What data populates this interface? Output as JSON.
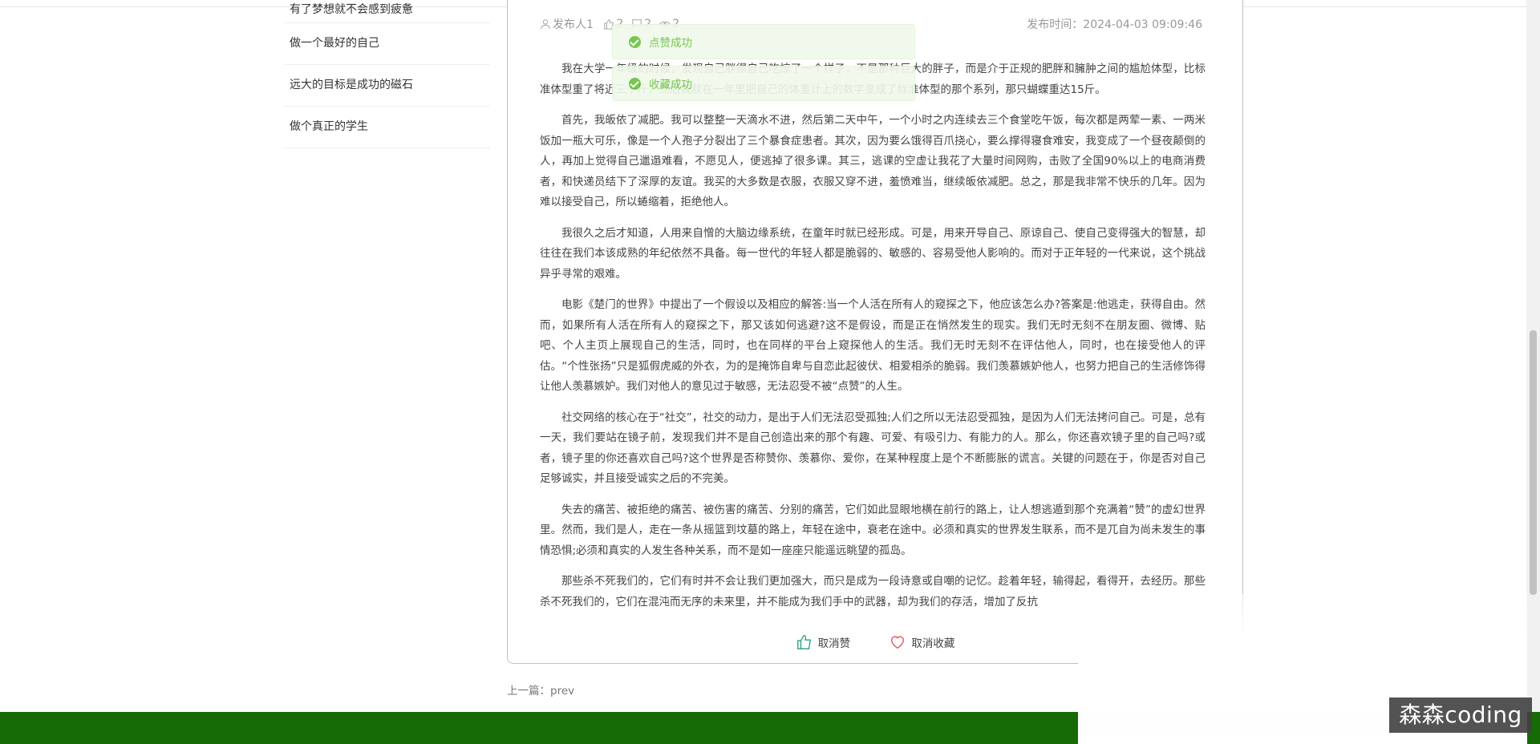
{
  "sidebar": {
    "items": [
      {
        "label": "有了梦想就不会感到疲惫"
      },
      {
        "label": "做一个最好的自己"
      },
      {
        "label": "远大的目标是成功的磁石"
      },
      {
        "label": "做个真正的学生"
      }
    ]
  },
  "article": {
    "author": "发布人1",
    "likes": "2",
    "comments": "2",
    "views": "2",
    "publish_time": "发布时间：2024-04-03 09:09:46",
    "paragraphs": [
      "我在大学一年级的时候，发现自己胖得自己吃惊了一个样子，不是那种巨大的胖子，而是介于正规的肥胖和臃肿之间的尴尬体型，比标准体型重了将近三十斤，然后我就在一年里把自己的体重计上的数字变成了标准体型的那个系列，那只蝴蝶重达15斤。",
      "首先，我皈依了减肥。我可以整整一天滴水不进，然后第二天中午，一个小时之内连续去三个食堂吃午饭，每次都是两荤一素、一两米饭加一瓶大可乐，像是一个人孢子分裂出了三个暴食症患者。其次，因为要么饿得百爪挠心，要么撑得寝食难安，我变成了一个昼夜颠倒的人，再加上觉得自己邋遢难看，不愿见人，便逃掉了很多课。其三，逃课的空虚让我花了大量时间网购，击败了全国90%以上的电商消费者，和快递员结下了深厚的友谊。我买的大多数是衣服，衣服又穿不进，羞愤难当，继续皈依减肥。总之，那是我非常不快乐的几年。因为难以接受自己，所以蜷缩着，拒绝他人。",
      "我很久之后才知道，人用来自憎的大脑边缘系统，在童年时就已经形成。可是，用来开导自己、原谅自己、使自己变得强大的智慧，却往往在我们本该成熟的年纪依然不具备。每一世代的年轻人都是脆弱的、敏感的、容易受他人影响的。而对于正年轻的一代来说，这个挑战异乎寻常的艰难。",
      "电影《楚门的世界》中提出了一个假设以及相应的解答:当一个人活在所有人的窥探之下，他应该怎么办?答案是:他逃走，获得自由。然而，如果所有人活在所有人的窥探之下，那又该如何逃避?这不是假设，而是正在悄然发生的现实。我们无时无刻不在朋友圈、微博、贴吧、个人主页上展现自己的生活，同时，也在同样的平台上窥探他人的生活。我们无时无刻不在评估他人，同时，也在接受他人的评估。“个性张扬”只是狐假虎威的外衣，为的是掩饰自卑与自恋此起彼伏、相爱相杀的脆弱。我们羡慕嫉妒他人，也努力把自己的生活修饰得让他人羡慕嫉妒。我们对他人的意见过于敏感，无法忍受不被“点赞”的人生。",
      "社交网络的核心在于“社交”，社交的动力，是出于人们无法忍受孤独;人们之所以无法忍受孤独，是因为人们无法拷问自己。可是，总有一天，我们要站在镜子前，发现我们并不是自己创造出来的那个有趣、可爱、有吸引力、有能力的人。那么，你还喜欢镜子里的自己吗?或者，镜子里的你还喜欢自己吗?这个世界是否称赞你、羡慕你、爱你，在某种程度上是个不断膨胀的谎言。关键的问题在于，你是否对自己足够诚实，并且接受诚实之后的不完美。",
      "失去的痛苦、被拒绝的痛苦、被伤害的痛苦、分别的痛苦，它们如此显眼地横在前行的路上，让人想逃遁到那个充满着“赞”的虚幻世界里。然而，我们是人，走在一条从摇篮到坟墓的路上，年轻在途中，衰老在途中。必须和真实的世界发生联系，而不是兀自为尚未发生的事情恐惧;必须和真实的人发生各种关系，而不是如一座座只能遥远眺望的孤岛。",
      "那些杀不死我们的，它们有时并不会让我们更加强大，而只是成为一段诗意或自嘲的记忆。趁着年轻，输得起，看得开，去经历。那些杀不死我们的，它们在混沌而无序的未来里，并不能成为我们手中的武器，却为我们的存活，增加了反抗"
    ],
    "unlike_label": "取消赞",
    "uncollect_label": "取消收藏",
    "prev_label": "上一篇：prev"
  },
  "toasts": {
    "like": "点赞成功",
    "collect": "收藏成功"
  },
  "watermark": "森森coding",
  "colors": {
    "footer": "#176b07",
    "toast_text": "#67c23a",
    "like_icon": "#3aa68a",
    "collect_icon": "#e55b6b"
  },
  "icons": [
    "user-icon",
    "thumb-up-icon",
    "comment-icon",
    "eye-icon",
    "heart-icon",
    "check-circle-icon"
  ]
}
